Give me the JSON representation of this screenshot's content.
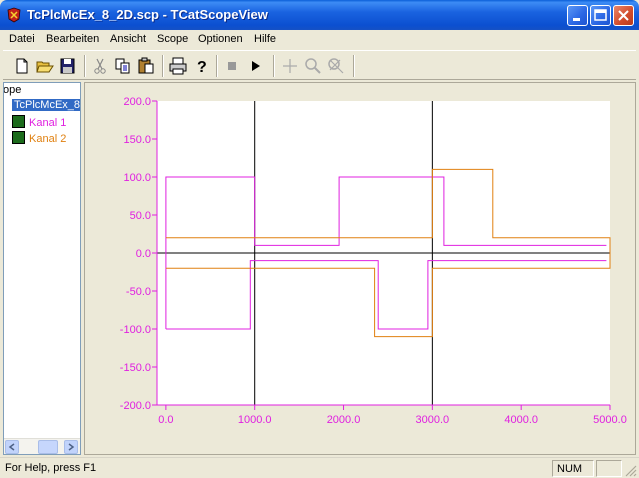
{
  "window": {
    "title": "TcPlcMcEx_8_2D.scp - TCatScopeView"
  },
  "menu": [
    "Datei",
    "Bearbeiten",
    "Ansicht",
    "Scope",
    "Optionen",
    "Hilfe"
  ],
  "toolbar_icons": [
    "new-file-icon",
    "open-folder-icon",
    "save-icon",
    "cut-icon",
    "copy-icon",
    "paste-icon",
    "print-icon",
    "help-icon",
    "stop-icon",
    "play-icon",
    "crosshair-icon",
    "zoom-icon",
    "zoom-reset-icon"
  ],
  "tree": {
    "root_label": "ope",
    "scope_label": "TcPlcMcEx_8",
    "channels": [
      {
        "label": "Kanal 1",
        "color": "#e020e0"
      },
      {
        "label": "Kanal 2",
        "color": "#e08010"
      }
    ]
  },
  "status": {
    "help_text": "For Help, press F1",
    "num": "NUM"
  },
  "chart_data": {
    "type": "line",
    "axis_color": "#e020e0",
    "xlim": [
      -100,
      5000
    ],
    "ylim": [
      -200,
      200
    ],
    "x_ticks": [
      0,
      1000,
      2000,
      3000,
      4000,
      5000
    ],
    "x_tick_labels": [
      "0.0",
      "1000.0",
      "2000.0",
      "3000.0",
      "4000.0",
      "5000.0"
    ],
    "y_ticks": [
      200,
      150,
      100,
      50,
      0,
      -50,
      -100,
      -150,
      -200
    ],
    "y_tick_labels": [
      "200.0",
      "150.0",
      "100.0",
      "50.0",
      "0.0",
      "-50.0",
      "-100.0",
      "-150.0",
      "-200.0"
    ],
    "vertical_lines": [
      1000,
      3000
    ],
    "series": [
      {
        "color": "#e020e0",
        "points": [
          [
            0,
            -100
          ],
          [
            0,
            100
          ],
          [
            1000,
            100
          ],
          [
            1000,
            10
          ],
          [
            1950,
            10
          ],
          [
            1950,
            100
          ],
          [
            3130,
            100
          ],
          [
            3130,
            10
          ],
          [
            4960,
            10
          ]
        ]
      },
      {
        "color": "#e020e0",
        "points": [
          [
            0,
            -100
          ],
          [
            950,
            -100
          ],
          [
            950,
            -10
          ],
          [
            2390,
            -10
          ],
          [
            2390,
            -100
          ],
          [
            2950,
            -100
          ],
          [
            2950,
            -10
          ],
          [
            4960,
            -10
          ]
        ]
      },
      {
        "color": "#e08010",
        "points": [
          [
            0,
            20
          ],
          [
            3000,
            20
          ],
          [
            3000,
            110
          ],
          [
            3680,
            110
          ],
          [
            3680,
            20
          ],
          [
            5000,
            20
          ],
          [
            5000,
            -20
          ],
          [
            3000,
            -20
          ],
          [
            3000,
            -110
          ],
          [
            2350,
            -110
          ],
          [
            2350,
            -20
          ],
          [
            0,
            -20
          ]
        ]
      }
    ]
  }
}
